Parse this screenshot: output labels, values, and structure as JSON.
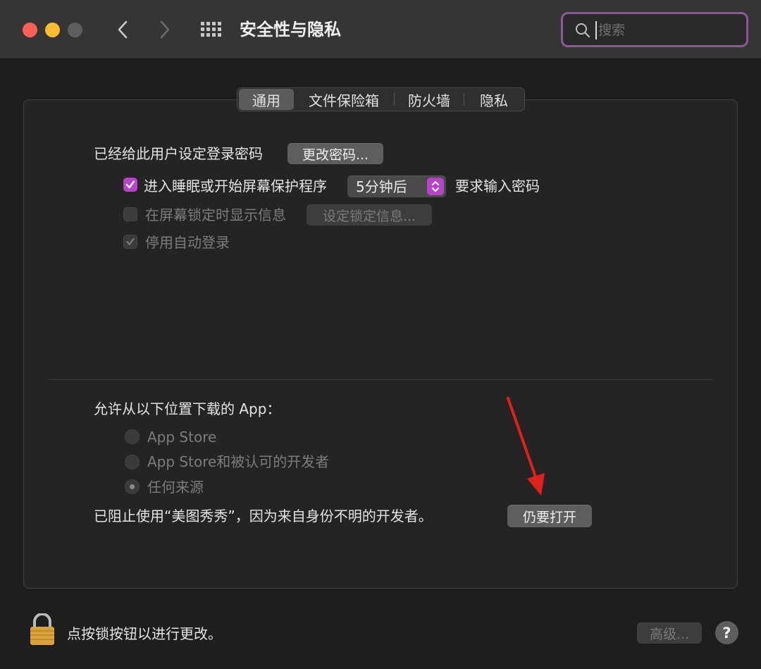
{
  "window": {
    "title": "安全性与隐私",
    "search_placeholder": "搜索"
  },
  "tabs": [
    {
      "label": "通用",
      "selected": true
    },
    {
      "label": "文件保险箱",
      "selected": false
    },
    {
      "label": "防火墙",
      "selected": false
    },
    {
      "label": "隐私",
      "selected": false
    }
  ],
  "general": {
    "password_set_label": "已经给此用户设定登录密码",
    "change_password_button": "更改密码...",
    "require_password": {
      "checked": true,
      "label": "进入睡眠或开始屏幕保护程序",
      "select_value": "5分钟后",
      "suffix": "要求输入密码"
    },
    "show_message": {
      "checked": false,
      "label": "在屏幕锁定时显示信息",
      "button": "设定锁定信息..."
    },
    "disable_autologin": {
      "checked": true,
      "label": "停用自动登录"
    }
  },
  "downloads": {
    "heading": "允许从以下位置下载的 App：",
    "options": [
      {
        "label": "App Store",
        "selected": false
      },
      {
        "label": "App Store和被认可的开发者",
        "selected": false
      },
      {
        "label": "任何来源",
        "selected": true
      }
    ],
    "blocked_message": "已阻止使用“美图秀秀”，因为来自身份不明的开发者。",
    "open_anyway_button": "仍要打开"
  },
  "footer": {
    "lock_text": "点按锁按钮以进行更改。",
    "advanced_button": "高级...",
    "help_button": "?"
  },
  "colors": {
    "accent": "#b743c9",
    "search_border": "#8a5a94",
    "annotation_arrow": "#e0201b"
  },
  "icons": [
    "back-chevron-icon",
    "forward-chevron-icon",
    "grid-icon",
    "search-icon",
    "checkmark-icon",
    "updown-arrows-icon",
    "lock-icon",
    "question-icon"
  ]
}
